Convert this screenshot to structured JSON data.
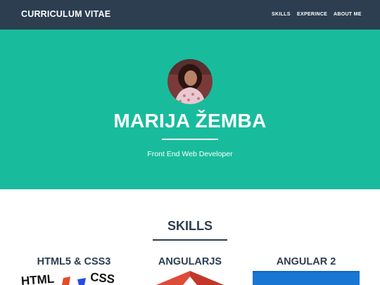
{
  "navbar": {
    "brand": "CURRICULUM VITAE",
    "links": [
      "SKILLS",
      "EXPERINCE",
      "ABOUT ME"
    ]
  },
  "hero": {
    "name": "MARIJA ŽEMBA",
    "subtitle": "Front End Web Developer"
  },
  "skills": {
    "title": "SKILLS",
    "items": [
      "HTML5 & CSS3",
      "ANGULARJS",
      "ANGULAR 2"
    ]
  },
  "logo_text": {
    "html": "HTML",
    "css": "CSS"
  },
  "colors": {
    "navbar": "#2c3e50",
    "hero": "#18bc9c",
    "text_dark": "#2c3e50",
    "angularjs_red": "#dd4b39",
    "angular2_blue": "#1976d2"
  }
}
